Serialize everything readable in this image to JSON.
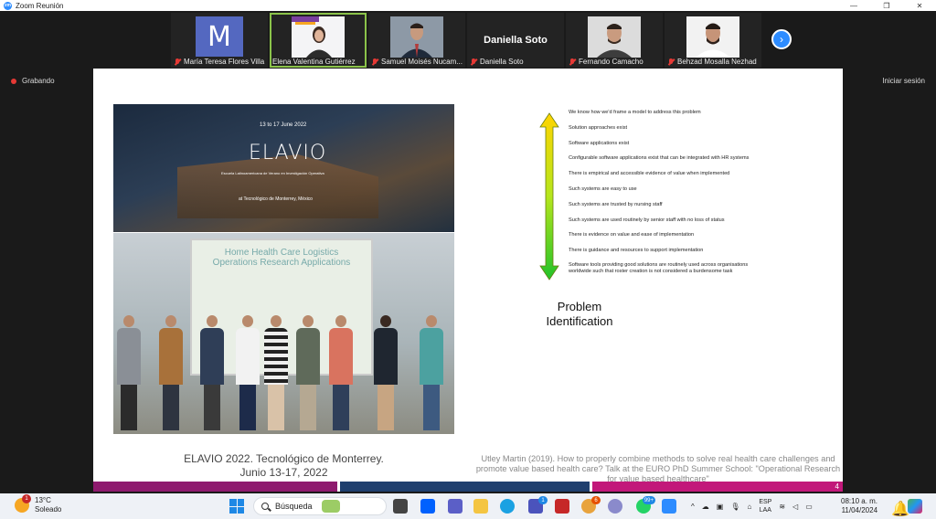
{
  "window": {
    "title": "Zoom Reunión",
    "app_icon": "zoom-icon"
  },
  "participants": [
    {
      "name": "María Teresa Flores Villa",
      "muted": true,
      "type": "avatar",
      "initial": "M"
    },
    {
      "name": "Elena Valentina Gutiérrez",
      "muted": false,
      "type": "video",
      "active_speaker": true
    },
    {
      "name": "Samuel Moisés Nucam...",
      "muted": true,
      "type": "video"
    },
    {
      "name": "Daniella Soto",
      "muted": true,
      "type": "name-only",
      "display_name": "Daniella Soto"
    },
    {
      "name": "Fernando Camacho",
      "muted": true,
      "type": "video"
    },
    {
      "name": "Behzad Mosalla Nezhad",
      "muted": true,
      "type": "video"
    }
  ],
  "recording": {
    "label": "Grabando"
  },
  "signin": {
    "label": "Iniciar sesión"
  },
  "slide": {
    "photo_top": {
      "date": "13 to 17 June 2022",
      "event": "ELAVIO",
      "event_sub": "Escuela Latinoamericana de Verano en Investigación Operativa",
      "venue": "at Tecnológico de Monterrey, México"
    },
    "photo_bottom": {
      "screen_title_1": "Home Health Care Logistics",
      "screen_title_2": "Operations Research Applications"
    },
    "caption_line1": "ELAVIO 2022. Tecnológico de Monterrey.",
    "caption_line2": "Junio 13-17, 2022",
    "steps": [
      "We know how we'd frame a model to address this problem",
      "Solution approaches exist",
      "Software applications exist",
      "Configurable software applications exist that can be integrated with HR systems",
      "There is empirical and accessible evidence of value when implemented",
      "Such systems are easy to use",
      "Such systems are trusted by nursing staff",
      "Such systems are used routinely by senior staff with no loss of status",
      "There is evidence on value and ease of implementation",
      "There is guidance and resources to support implementation",
      "Software tools providing good solutions are routinely used  across organisations worldwide such that roster creation is not considered a burdensome task"
    ],
    "problem_line1": "Problem",
    "problem_line2": "Identification",
    "reference": "Utley Martin (2019). How to properly combine methods to solve real health care challenges and promote value based health care? Talk at the EURO PhD Summer School: \"Operational Research for value based healthcare\"",
    "page_number": "4",
    "bar_colors": [
      "#8e1a6e",
      "#ffffff",
      "#1f3f6e",
      "#ffffff",
      "#c2187a"
    ]
  },
  "taskbar": {
    "weather_temp": "13°C",
    "weather_desc": "Soleado",
    "weather_badge": "1",
    "search_placeholder": "Búsqueda",
    "teams_badge": "1",
    "chrome_badge": "6",
    "whatsapp_badge": "99+",
    "lang_1": "ESP",
    "lang_2": "LAA",
    "time": "08:10 a. m.",
    "date": "11/04/2024"
  }
}
